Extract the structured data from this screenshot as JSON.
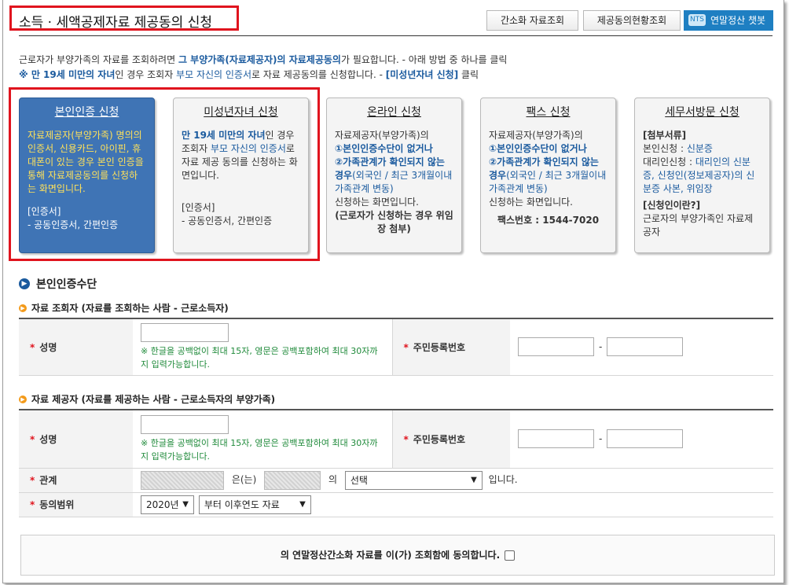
{
  "header": {
    "title": "소득 · 세액공제자료 제공동의 신청",
    "btn_simple_lookup": "간소화 자료조회",
    "btn_status_lookup": "제공동의현황조회",
    "btn_chatbot": "연말정산 챗봇",
    "chatbot_icon_text": "NTS"
  },
  "intro": {
    "line1_a": "근로자가 부양가족의 자료를 조회하려면 ",
    "line1_b": "그 부양가족(자료제공자)의 자료제공동의",
    "line1_c": "가 필요합니다. - 아래 방법 중 하나를 클릭",
    "line2_a": "※ 만 19세 미만의 자녀",
    "line2_b": "인 경우 조회자 ",
    "line2_c": "부모 자신의 인증서",
    "line2_d": "로 자료 제공동의를 신청합니다. - ",
    "line2_e": "[미성년자녀 신청]",
    "line2_f": " 클릭"
  },
  "cards": {
    "self": {
      "title": "본인인증 신청",
      "desc": "자료제공자(부양가족) 명의의 인증서, 신용카드, 아이핀, 휴대폰이 있는 경우 본인 인증을 통해 자료제공동의를 신청하는 화면입니다.",
      "cert_head": "[인증서]",
      "cert_body": "- 공동인증서, 간편인증"
    },
    "minor": {
      "title": "미성년자녀 신청",
      "desc_a": "만 19세 미만의 자녀",
      "desc_b": "인 경우 조회자 ",
      "desc_c": "부모 자신의 인증서",
      "desc_d": "로 자료 제공 동의를 신청하는 화면입니다.",
      "cert_head": "[인증서]",
      "cert_body": "- 공동인증서, 간편인증"
    },
    "online": {
      "title": "온라인 신청",
      "desc_a": "자료제공자(부양가족)의",
      "desc_b": "①본인인증수단이 없거나",
      "desc_c": "②가족관계가 확인되지 않는 경우",
      "desc_d": "(외국인 / 최근 3개월이내 가족관계 변동)",
      "desc_e": "신청하는 화면입니다.",
      "desc_f": "(근로자가 신청하는 경우 위임장 첨부)"
    },
    "fax": {
      "title": "팩스 신청",
      "desc_a": "자료제공자(부양가족)의",
      "desc_b": "①본인인증수단이 없거나",
      "desc_c": "②가족관계가 확인되지 않는 경우",
      "desc_d": "(외국인 / 최근 3개월이내 가족관계 변동)",
      "desc_e": "신청하는 화면입니다.",
      "fax_no": "팩스번호 : 1544-7020"
    },
    "visit": {
      "title": "세무서방문 신청",
      "attach_head": "[첨부서류]",
      "self_a": "본인신청 : ",
      "self_b": "신분증",
      "proxy_a": "대리인신청 : ",
      "proxy_b": "대리인의 신분증, 신청인(정보제공자)의 신분증 사본, 위임장",
      "who_head": "[신청인이란?]",
      "who_body": "근로자의 부양가족인 자료제공자"
    }
  },
  "section": {
    "title": "본인인증수단",
    "viewer_head": "자료 조회자 (자료를 조회하는 사람 - 근로소득자)",
    "provider_head": "자료 제공자 (자료를 제공하는 사람 - 근로소득자의 부양가족)"
  },
  "form": {
    "name_label": "성명",
    "rrn_label": "주민등록번호",
    "name_note": "※ 한글을 공백없이 최대 15자, 영문은 공백포함하여 최대 30자까지 입력가능합니다.",
    "dash": "-",
    "relation_label": "관계",
    "relation_text1": "은(는)",
    "relation_text2": "의",
    "relation_select": "선택",
    "relation_text3": "입니다.",
    "scope_label": "동의범위",
    "year_select": "2020년",
    "scope_select": "부터 이후연도 자료",
    "agree_text": "의 연말정산간소화 자료를 이(가) 조회함에 동의합니다."
  }
}
